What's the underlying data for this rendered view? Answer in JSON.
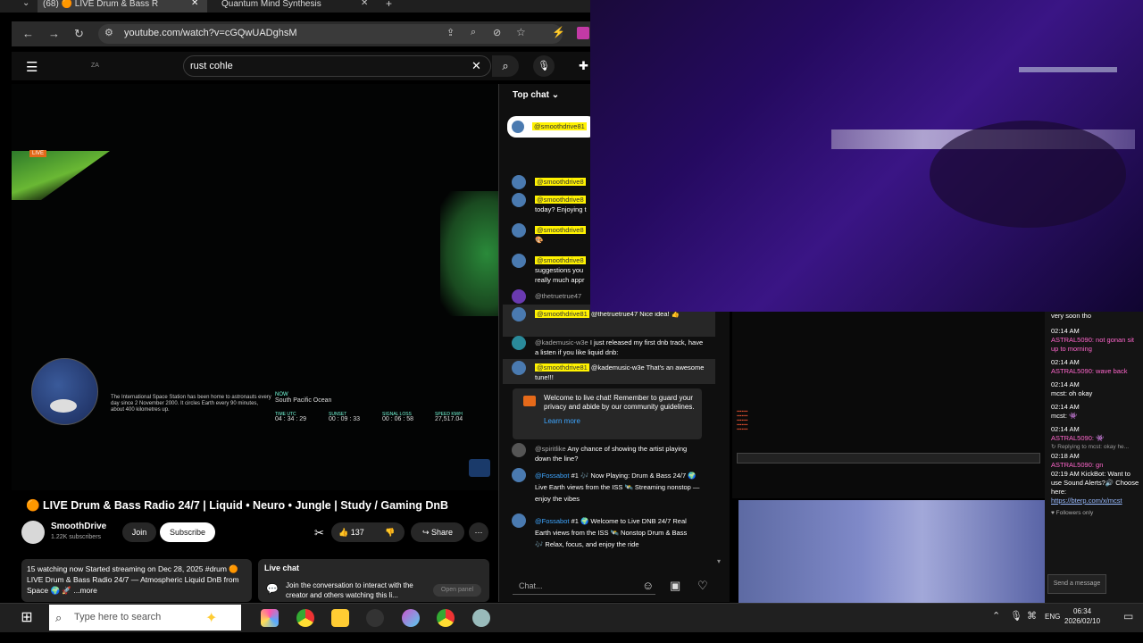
{
  "browser": {
    "tab_active": "(68) 🟠 LIVE Drum & Bass R",
    "tab_2": "Quantum Mind Synthesis",
    "url": "youtube.com/watch?v=cGQwUADghsM"
  },
  "youtube": {
    "logo_text": "ZA",
    "search_value": "rust cohle",
    "video": {
      "live_label": "LIVE",
      "iss_text": "The International Space Station has been home to astronauts every day since 2 November 2000. It circles Earth every 90 minutes, about 400 kilometres up.",
      "now_label": "NOW",
      "now_value": "South Pacific Ocean",
      "stats": [
        {
          "label": "TIME UTC",
          "value": "04 : 34 : 29"
        },
        {
          "label": "SUNSET",
          "value": "00 : 09 : 33"
        },
        {
          "label": "SIGNAL LOSS",
          "value": "00 : 06 : 58"
        },
        {
          "label": "SPEED KM/H",
          "value": "27,517.04"
        }
      ]
    },
    "title": "🟠 LIVE Drum & Bass Radio 24/7 | Liquid • Neuro • Jungle | Study / Gaming DnB",
    "channel_name": "SmoothDrive",
    "subscribers": "1.22K subscribers",
    "join_label": "Join",
    "subscribe_label": "Subscribe",
    "like_count": "137",
    "share_label": "Share",
    "description": "15 watching now  Started streaming on Dec 28, 2025  #drum 🟠 LIVE Drum & Bass Radio 24/7 — Atmospheric Liquid DnB from Space 🌍 🚀  ...more",
    "live_chat_box": {
      "title": "Live chat",
      "text": "Join the conversation to interact with the creator and others watching this li...",
      "button": "Open panel"
    }
  },
  "chat": {
    "header": "Top chat",
    "pinned_name": "@smoothdrive81",
    "messages": [
      {
        "name": "@smoothdrive8",
        "text": ""
      },
      {
        "name": "@smoothdrive8",
        "text": "today? Enjoying t"
      },
      {
        "name": "@smoothdrive8",
        "text": "🎨"
      },
      {
        "name": "@smoothdrive8",
        "text": "suggestions you really much appr"
      },
      {
        "name": "@thetruetrue47",
        "text": ""
      },
      {
        "name": "@smoothdrive81",
        "text": "@thetruetrue47 Nice idea! 👍"
      },
      {
        "name": "@kademusic-w3e",
        "text": "I just released my first dnb track, have a listen if you like liquid dnb:"
      },
      {
        "name": "@smoothdrive81",
        "text": "@kademusic-w3e That's an awesome tune!!!"
      },
      {
        "name": "@spiritlike",
        "text": "Any chance of showing the artist playing down the line?"
      },
      {
        "name": "@Fossabot",
        "text": "#1 🎶 Now Playing: Drum & Bass 24/7 🌍 Live Earth views from the ISS 🛰️ Streaming nonstop — enjoy the vibes"
      },
      {
        "name": "@Fossabot",
        "text": "#1 🌍 Welcome to Live DNB 24/7 Real Earth views from the ISS 🛰️ Nonstop Drum & Bass 🎶 Relax, focus, and enjoy the ride"
      }
    ],
    "welcome_text": "Welcome to live chat! Remember to guard your privacy and abide by our community guidelines.",
    "learn_more": "Learn more",
    "input_placeholder": "Chat..."
  },
  "twitch_chat": {
    "lines": [
      "very soon tho",
      "02:14 AM",
      "ASTRAL5090: not gonan sit up to morning",
      "02:14 AM",
      "ASTRAL5090: wave back",
      "02:14 AM",
      "mcst: oh okay",
      "02:14 AM",
      "mcst: 👾",
      "02:14 AM",
      "ASTRAL5090: 👾",
      "↻ Replying to mcst: okay he...",
      "02:18 AM",
      "ASTRAL5090: gn",
      "02:19 AM  KickBot: Want to use Sound Alerts?🔊 Choose here:",
      "https://bterp.com/x/mcst",
      "♥ Followers only"
    ],
    "send_label": "Send a message"
  },
  "taskbar": {
    "search_placeholder": "Type here to search",
    "lang": "ENG",
    "time": "06:34",
    "date": "2026/02/10"
  }
}
